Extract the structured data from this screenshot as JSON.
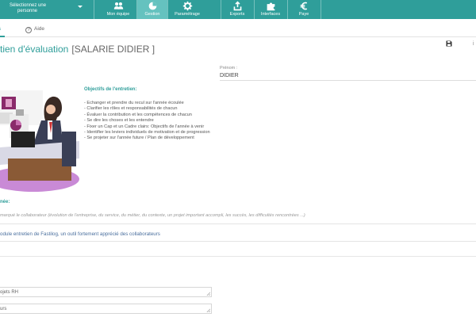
{
  "topbar": {
    "person_select_line1": "Sélectionnez une",
    "person_select_line2": "personne",
    "nav": [
      {
        "label": "Mon équipe",
        "icon": "team-icon"
      },
      {
        "label": "Gestion",
        "icon": "pie-chart-icon"
      },
      {
        "label": "Paramétrage",
        "icon": "gear-icon"
      },
      {
        "label": "Exports",
        "icon": "export-icon"
      },
      {
        "label": "Interfaces",
        "icon": "puzzle-icon"
      },
      {
        "label": "Paye",
        "icon": "euro-icon"
      }
    ],
    "accent": "#2f9e9a",
    "active": "#65c2bf"
  },
  "tabs": {
    "aide": "Aide"
  },
  "header": {
    "title": "tien d'évaluation",
    "employee": "[SALARIE DIDIER ]"
  },
  "prenom": {
    "label": "Prénom :",
    "value": "DIDIER"
  },
  "objectives": {
    "title": "Objectifs de l'entretien:",
    "items": [
      "- Echanger et prendre du recul sur l'année écoulée",
      "- Clarifier les rôles et responsabilités de chacun",
      "- Évaluer la contribution et les compétences de chacun",
      "- Se dire les choses et les entendre",
      "- Fixer un Cap et un Cadre clairs: Objectifs de l'année à venir",
      "- Identifier les leviers individuels de motivation et de progression",
      "- Se projeter sur l'année future / Plan de développement"
    ]
  },
  "section": {
    "title": "née:",
    "remark_placeholder": "marqué le collaborateur (évolution de l'entreprise, du service, du métier, du contexte, un projet important accompli, les succès, les difficultés rencontrées ...)",
    "module_text": "odule entretien de Fastilog, un outil fortement apprécié des collaborateurs"
  },
  "fields": {
    "field1": "ojets RH",
    "field2": "urs"
  }
}
